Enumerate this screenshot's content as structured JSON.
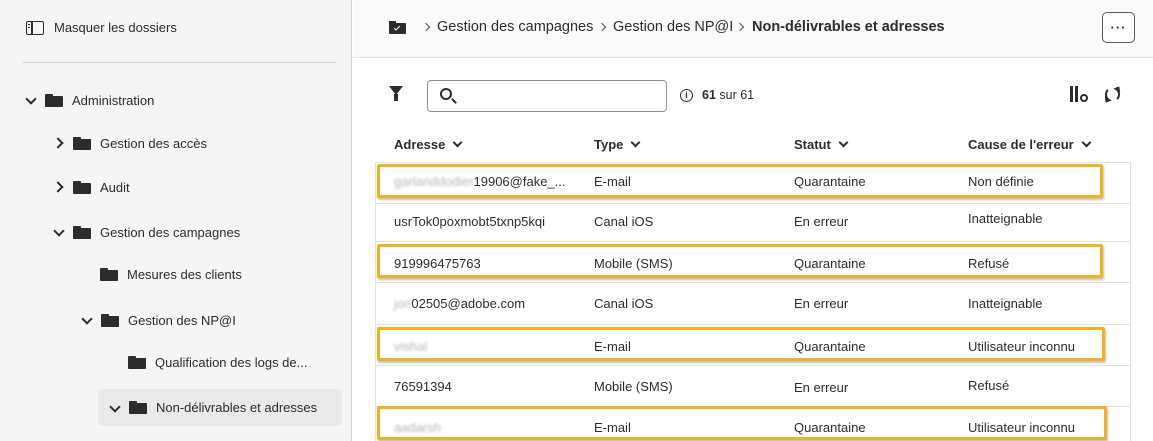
{
  "sidebar": {
    "hide_folders_label": "Masquer les dossiers",
    "tree": [
      {
        "label": "Administration",
        "chevron": "down"
      },
      {
        "label": "Gestion des accès",
        "chevron": "right"
      },
      {
        "label": "Audit",
        "chevron": "right"
      },
      {
        "label": "Gestion des campagnes",
        "chevron": "down"
      },
      {
        "label": "Mesures des clients",
        "chevron": "none"
      },
      {
        "label": "Gestion des NP@I",
        "chevron": "down"
      },
      {
        "label": "Qualification des logs de...",
        "chevron": "none"
      },
      {
        "label": "Non-délivrables et adresses",
        "chevron": "down",
        "selected": true
      }
    ]
  },
  "breadcrumb": {
    "items": [
      "Gestion des campagnes",
      "Gestion des NP@I"
    ],
    "current": "Non-délivrables et adresses",
    "more_label": "···"
  },
  "toolbar": {
    "search_placeholder": "",
    "search_value": "",
    "count_current": "61",
    "count_rest": "sur 61"
  },
  "table": {
    "columns": [
      "Adresse",
      "Type",
      "Statut",
      "Cause de l'erreur"
    ],
    "rows": [
      {
        "address_blurred": "garlanddodier",
        "address_visible": "19906@fake_...",
        "type": "E-mail",
        "status": "Quarantaine",
        "cause": "Non définie",
        "highlighted": true
      },
      {
        "address_blurred": "",
        "address_visible": "usrTok0poxmobt5txnp5kqi",
        "type": "Canal iOS",
        "status": "En erreur",
        "cause": "Inatteignable",
        "highlighted": false
      },
      {
        "address_blurred": "",
        "address_visible": "919996475763",
        "type": "Mobile (SMS)",
        "status": "Quarantaine",
        "cause": "Refusé",
        "highlighted": true
      },
      {
        "address_blurred": "jon",
        "address_visible": "02505@adobe.com",
        "type": "Canal iOS",
        "status": "En erreur",
        "cause": "Inatteignable",
        "highlighted": false
      },
      {
        "address_blurred": "vishal",
        "address_visible": "",
        "type": "E-mail",
        "status": "Quarantaine",
        "cause": "Utilisateur inconnu",
        "highlighted": true
      },
      {
        "address_blurred": "",
        "address_visible": "76591394",
        "type": "Mobile (SMS)",
        "status": "En erreur",
        "cause": "Refusé",
        "highlighted": false
      },
      {
        "address_blurred": "aadarsh",
        "address_visible": "",
        "type": "E-mail",
        "status": "Quarantaine",
        "cause": "Utilisateur inconnu",
        "highlighted": true
      }
    ]
  },
  "colors": {
    "highlight": "#f0b31a",
    "sidebar_bg": "#f5f5f5",
    "text": "#2c2c2c"
  }
}
